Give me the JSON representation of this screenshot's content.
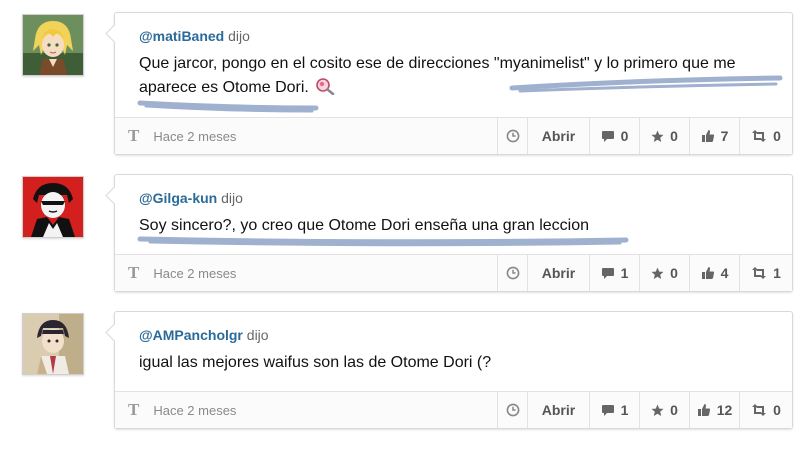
{
  "comments": [
    {
      "username": "@matiBaned",
      "dijo": "dijo",
      "text": "Que jarcor, pongo en el cosito ese de direcciones \"myanimelist\" y lo primero que me aparece es Otome Dori.",
      "time": "Hace 2 meses",
      "open_label": "Abrir",
      "replies": "0",
      "favorites": "0",
      "likes": "7",
      "reposts": "0"
    },
    {
      "username": "@Gilga-kun",
      "dijo": "dijo",
      "text": "Soy sincero?, yo creo que Otome Dori enseña una gran leccion",
      "time": "Hace 2 meses",
      "open_label": "Abrir",
      "replies": "1",
      "favorites": "0",
      "likes": "4",
      "reposts": "1"
    },
    {
      "username": "@AMPancholgr",
      "dijo": "dijo",
      "text": "igual las mejores waifus son las de Otome Dori (?",
      "time": "Hace 2 meses",
      "open_label": "Abrir",
      "replies": "1",
      "favorites": "0",
      "likes": "12",
      "reposts": "0"
    }
  ],
  "colors": {
    "username": "#2b6a99",
    "highlight_scribble": "#7f97bf"
  },
  "icons": {
    "type": "t-letter-icon",
    "clock": "clock-icon",
    "reply": "speech-bubble-icon",
    "favorite": "star-icon",
    "like": "thumbs-up-icon",
    "repost": "retweet-icon",
    "emoji": "magnifier-emoji-icon"
  }
}
